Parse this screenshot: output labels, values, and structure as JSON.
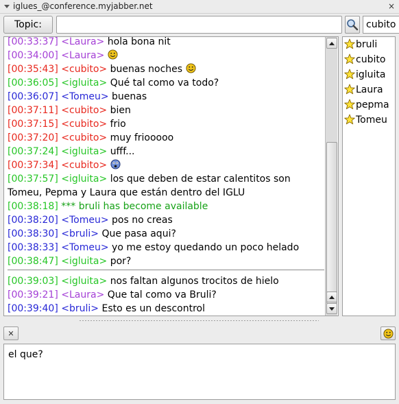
{
  "window": {
    "title": "iglues_@conference.myjabber.net",
    "close_glyph": "×"
  },
  "toolbar": {
    "topic_label": "Topic:",
    "topic_value": "",
    "nick": "cubito"
  },
  "icons": {
    "search": "search-icon",
    "smiley": "smiley-icon",
    "star": "star-icon",
    "clear": "clear-icon"
  },
  "colors": {
    "cubito": "#e8281e",
    "igluita": "#26c626",
    "tomeu": "#2727d6",
    "laura": "#a43fd6",
    "bruli": "#2727d6",
    "system": "#17a217"
  },
  "chat": {
    "lines_before": [
      {
        "ts": "[00:33:37]",
        "nick": "<Laura>",
        "color": "purple",
        "msg": "hola bona nit",
        "smiley": false
      },
      {
        "ts": "[00:34:00]",
        "nick": "<Laura>",
        "color": "purple",
        "msg": "",
        "smiley": true
      },
      {
        "ts": "[00:35:43]",
        "nick": "<cubito>",
        "color": "red",
        "msg": "buenas noches",
        "smiley": true
      },
      {
        "ts": "[00:36:05]",
        "nick": "<igluita>",
        "color": "green",
        "msg": "Qué tal como va todo?",
        "smiley": false
      },
      {
        "ts": "[00:36:07]",
        "nick": "<Tomeu>",
        "color": "blue",
        "msg": "buenas",
        "smiley": false
      },
      {
        "ts": "[00:37:11]",
        "nick": "<cubito>",
        "color": "red",
        "msg": "bien",
        "smiley": false
      },
      {
        "ts": "[00:37:15]",
        "nick": "<cubito>",
        "color": "red",
        "msg": "frio",
        "smiley": false
      },
      {
        "ts": "[00:37:20]",
        "nick": "<cubito>",
        "color": "red",
        "msg": "muy friooooo",
        "smiley": false
      },
      {
        "ts": "[00:37:24]",
        "nick": "<igluita>",
        "color": "green",
        "msg": "ufff...",
        "smiley": false
      },
      {
        "ts": "[00:37:34]",
        "nick": "<cubito>",
        "color": "red",
        "msg": "",
        "smiley": "shocked"
      },
      {
        "ts": "[00:37:57]",
        "nick": "<igluita>",
        "color": "green",
        "msg": "los que deben de estar calentitos son Tomeu, Pepma y Laura que están dentro del IGLU",
        "smiley": false,
        "wrap": true
      },
      {
        "ts": "[00:38:18]",
        "nick": "",
        "color": "green",
        "msg": "*** bruli has become available",
        "smiley": false,
        "system": true
      },
      {
        "ts": "[00:38:20]",
        "nick": "<Tomeu>",
        "color": "blue",
        "msg": "pos no creas",
        "smiley": false
      },
      {
        "ts": "[00:38:30]",
        "nick": "<bruli>",
        "color": "blue",
        "msg": "Que pasa aqui?",
        "smiley": false
      },
      {
        "ts": "[00:38:33]",
        "nick": "<Tomeu>",
        "color": "blue",
        "msg": "yo me estoy quedando un poco helado",
        "smiley": false
      },
      {
        "ts": "[00:38:47]",
        "nick": "<igluita>",
        "color": "green",
        "msg": "por?",
        "smiley": false
      }
    ],
    "lines_after": [
      {
        "ts": "[00:39:03]",
        "nick": "<igluita>",
        "color": "green",
        "msg": "nos faltan algunos trocitos de hielo",
        "smiley": false
      },
      {
        "ts": "[00:39:21]",
        "nick": "<Laura>",
        "color": "purple",
        "msg": "Que tal como va Bruli?",
        "smiley": false
      },
      {
        "ts": "[00:39:40]",
        "nick": "<bruli>",
        "color": "blue",
        "msg": "Esto es un descontrol",
        "smiley": false
      }
    ]
  },
  "roster": {
    "members": [
      "bruli",
      "cubito",
      "igluita",
      "Laura",
      "pepma",
      "Tomeu"
    ]
  },
  "compose": {
    "value": "el que?"
  },
  "bottom": {
    "clear_glyph": "✕"
  }
}
